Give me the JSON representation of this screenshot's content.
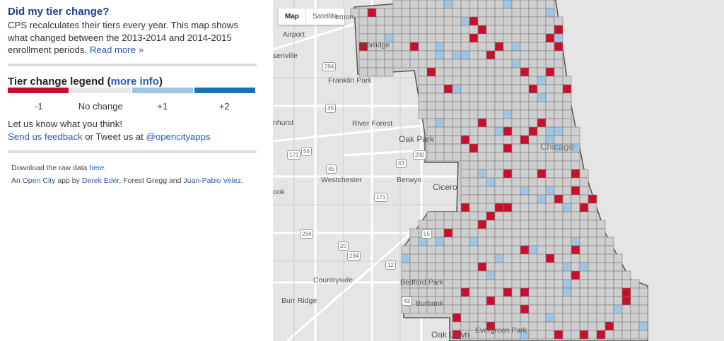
{
  "sidebar": {
    "title": "Did my tier change?",
    "intro_text": "CPS recalculates their tiers every year. This map shows what changed between the 2013-2014 and 2014-2015 enrollment periods.",
    "read_more": "Read more »",
    "legend": {
      "title": "Tier change legend",
      "paren_open": "(",
      "more_info": "more info",
      "paren_close": ")",
      "items": [
        {
          "label": "-1",
          "color": "#c8102e"
        },
        {
          "label": "No change",
          "color": "#e8e8e8"
        },
        {
          "label": "+1",
          "color": "#9ec5e3"
        },
        {
          "label": "+2",
          "color": "#1f6fb3"
        }
      ]
    },
    "feedback": {
      "prompt": "Let us know what you think!",
      "send_link": "Send us feedback",
      "or_text": " or Tweet us at ",
      "twitter": "@opencityapps"
    },
    "download": {
      "text": "Download the raw data ",
      "link": "here",
      "end": "."
    },
    "credits": {
      "prefix": "An ",
      "app_link": "Open City",
      "mid": " app by ",
      "author1": "Derek Eder",
      "mid2": ", Forest Gregg and ",
      "author2": "Juan-Pablo Velez",
      "end": "."
    }
  },
  "map": {
    "toggle": {
      "map": "Map",
      "satellite": "Satellite"
    },
    "labels": {
      "norridge": "Norridge",
      "franklin_park": "Franklin Park",
      "river_forest": "River Forest",
      "oak_park": "Oak Park",
      "chicago": "Chicago",
      "westchester": "Westchester",
      "berwyn": "Berwyn",
      "cicero": "Cicero",
      "countryside": "Countryside",
      "bedford_park": "Bedford Park",
      "burr_ridge": "Burr Ridge",
      "burbank": "Burbank",
      "oak_lawn": "Oak Lawn",
      "evergreen_park": "Evergreen Park",
      "airport": "Airport",
      "ook": "ook",
      "senville": "senville",
      "nhurst": "nhurst",
      "emon": "emon"
    },
    "shields": [
      "294",
      "45",
      "171",
      "290",
      "56",
      "43",
      "55",
      "45",
      "294",
      "171",
      "43",
      "294",
      "12",
      "20"
    ]
  }
}
